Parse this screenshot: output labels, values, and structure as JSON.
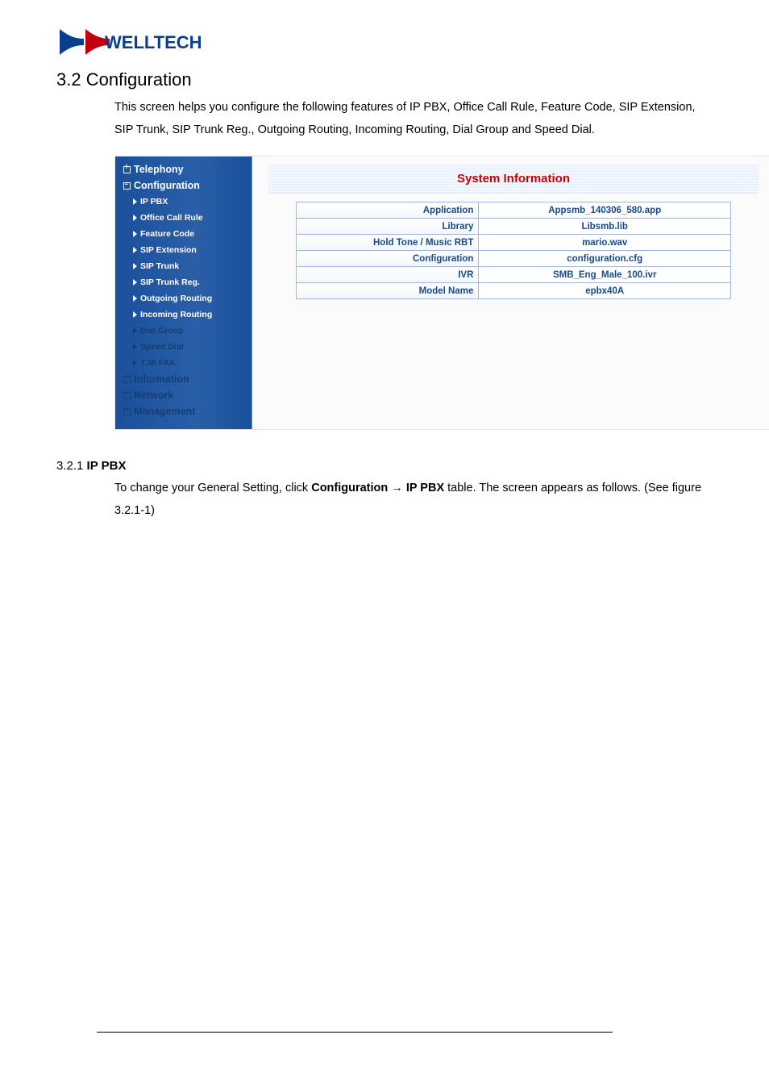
{
  "logo_text": "WELLTECH",
  "heading_1": "3.2  Configuration",
  "para_1": "This screen helps you configure the following features of IP PBX, Office Call Rule, Feature Code, SIP Extension, SIP Trunk, SIP Trunk Reg., Outgoing Routing, Incoming Routing, Dial Group and Speed Dial.",
  "sidebar": {
    "telephony": "Telephony",
    "configuration": "Configuration",
    "items": [
      "IP PBX",
      "Office Call Rule",
      "Feature Code",
      "SIP Extension",
      "SIP Trunk",
      "SIP Trunk Reg.",
      "Outgoing Routing",
      "Incoming Routing",
      "Dial Group",
      "Speed Dial",
      "T.38 FAX"
    ],
    "information": "Information",
    "network": "Network",
    "management": "Management"
  },
  "panel_title": "System Information",
  "rows": [
    {
      "k": "Application",
      "v": "Appsmb_140306_580.app"
    },
    {
      "k": "Library",
      "v": "Libsmb.lib"
    },
    {
      "k": "Hold Tone / Music RBT",
      "v": "mario.wav"
    },
    {
      "k": "Configuration",
      "v": "configuration.cfg"
    },
    {
      "k": "IVR",
      "v": "SMB_Eng_Male_100.ivr"
    },
    {
      "k": "Model Name",
      "v": "epbx40A"
    }
  ],
  "heading_2_num": "3.2.1 ",
  "heading_2_title": "IP PBX",
  "para_2_a": "To change your General Setting, click ",
  "para_2_b": "Configuration",
  "para_2_arrow": " → ",
  "para_2_c": "IP PBX",
  "para_2_d": " table. The screen appears as follows. (See figure 3.2.1-1)"
}
